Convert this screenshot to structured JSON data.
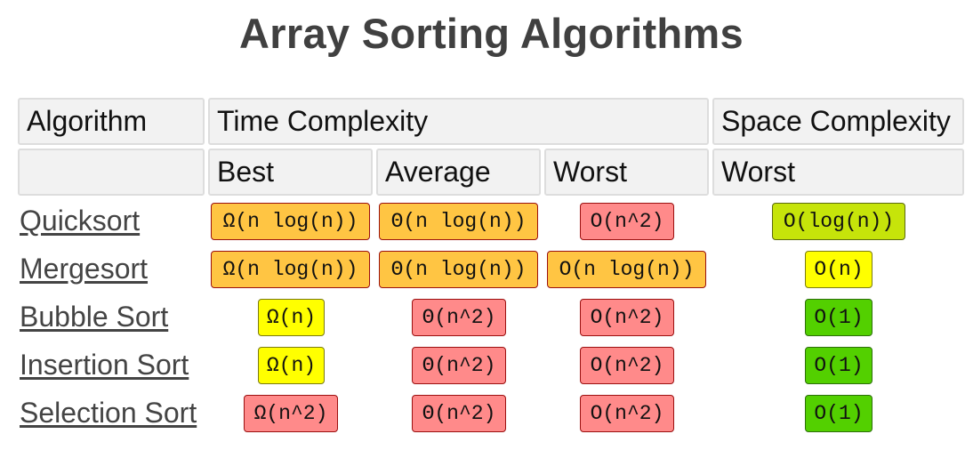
{
  "title": "Array Sorting Algorithms",
  "headers": {
    "algorithm": "Algorithm",
    "time_complexity": "Time Complexity",
    "space_complexity": "Space Complexity",
    "best": "Best",
    "average": "Average",
    "worst": "Worst",
    "space_worst": "Worst"
  },
  "colors": {
    "orange": "#ffc543",
    "red": "#ff8a8a",
    "yellow": "#ffff00",
    "lime": "#c6e40a",
    "green": "#53d000"
  },
  "rows": [
    {
      "name": "Quicksort",
      "best": {
        "text": "Ω(n log(n))",
        "color": "orange"
      },
      "avg": {
        "text": "Θ(n log(n))",
        "color": "orange"
      },
      "worst": {
        "text": "O(n^2)",
        "color": "red"
      },
      "space": {
        "text": "O(log(n))",
        "color": "lime"
      }
    },
    {
      "name": "Mergesort",
      "best": {
        "text": "Ω(n log(n))",
        "color": "orange"
      },
      "avg": {
        "text": "Θ(n log(n))",
        "color": "orange"
      },
      "worst": {
        "text": "O(n log(n))",
        "color": "orange"
      },
      "space": {
        "text": "O(n)",
        "color": "yellow"
      }
    },
    {
      "name": "Bubble Sort",
      "best": {
        "text": "Ω(n)",
        "color": "yellow"
      },
      "avg": {
        "text": "Θ(n^2)",
        "color": "red"
      },
      "worst": {
        "text": "O(n^2)",
        "color": "red"
      },
      "space": {
        "text": "O(1)",
        "color": "green"
      }
    },
    {
      "name": "Insertion Sort",
      "best": {
        "text": "Ω(n)",
        "color": "yellow"
      },
      "avg": {
        "text": "Θ(n^2)",
        "color": "red"
      },
      "worst": {
        "text": "O(n^2)",
        "color": "red"
      },
      "space": {
        "text": "O(1)",
        "color": "green"
      }
    },
    {
      "name": "Selection Sort",
      "best": {
        "text": "Ω(n^2)",
        "color": "red"
      },
      "avg": {
        "text": "Θ(n^2)",
        "color": "red"
      },
      "worst": {
        "text": "O(n^2)",
        "color": "red"
      },
      "space": {
        "text": "O(1)",
        "color": "green"
      }
    }
  ]
}
